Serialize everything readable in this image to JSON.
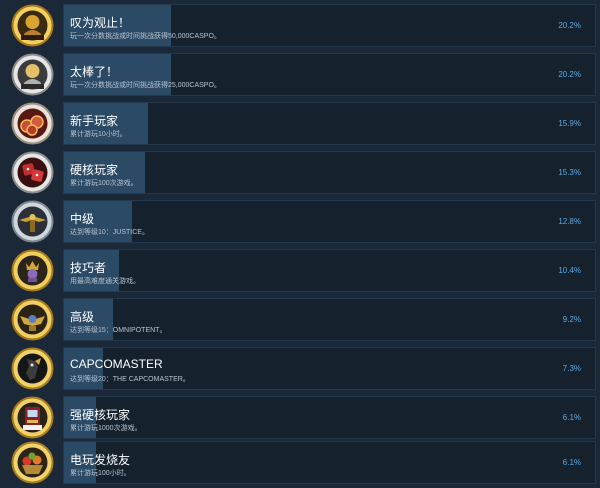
{
  "achievements": [
    {
      "title": "叹为观止！",
      "description": "玩一次分数挑战或时间挑战获得50,000CASPO。",
      "percent": "20.2%",
      "progress": 0.202,
      "icon": "gold-bearded-fighter-icon",
      "icon_color": "#d8a531"
    },
    {
      "title": "太棒了！",
      "description": "玩一次分数挑战或时间挑战获得25,000CASPO。",
      "percent": "20.2%",
      "progress": 0.202,
      "icon": "silver-bearded-fighter-icon",
      "icon_color": "#c9c9c9"
    },
    {
      "title": "新手玩家",
      "description": "累计游玩10小时。",
      "percent": "15.9%",
      "progress": 0.159,
      "icon": "red-coins-icon",
      "icon_color": "#c94b3a"
    },
    {
      "title": "硬核玩家",
      "description": "累计游玩100次游戏。",
      "percent": "15.3%",
      "progress": 0.153,
      "icon": "red-dice-icon",
      "icon_color": "#c12e2e"
    },
    {
      "title": "中级",
      "description": "达到等级10：JUSTICE。",
      "percent": "12.8%",
      "progress": 0.128,
      "icon": "winged-crest-icon",
      "icon_color": "#c9a13a"
    },
    {
      "title": "技巧者",
      "description": "用最高难度通关游戏。",
      "percent": "10.4%",
      "progress": 0.104,
      "icon": "crowned-figure-icon",
      "icon_color": "#d0a640"
    },
    {
      "title": "高级",
      "description": "达到等级15：OMNIPOTENT。",
      "percent": "9.2%",
      "progress": 0.092,
      "icon": "winged-emblem-icon",
      "icon_color": "#d4a939"
    },
    {
      "title": "CAPCOMASTER",
      "description": "达到等级20：THE CAPCOMASTER。",
      "percent": "7.3%",
      "progress": 0.073,
      "icon": "dark-warrior-icon",
      "icon_color": "#d6ad3e"
    },
    {
      "title": "强硬核玩家",
      "description": "累计游玩1000次游戏。",
      "percent": "6.1%",
      "progress": 0.061,
      "icon": "arcade-machine-icon",
      "icon_color": "#d5aa3c"
    },
    {
      "title": "电玩发烧友",
      "description": "累计游玩100小时。",
      "percent": "6.1%",
      "progress": 0.061,
      "icon": "fruit-basket-icon",
      "icon_color": "#d8b03f"
    }
  ]
}
